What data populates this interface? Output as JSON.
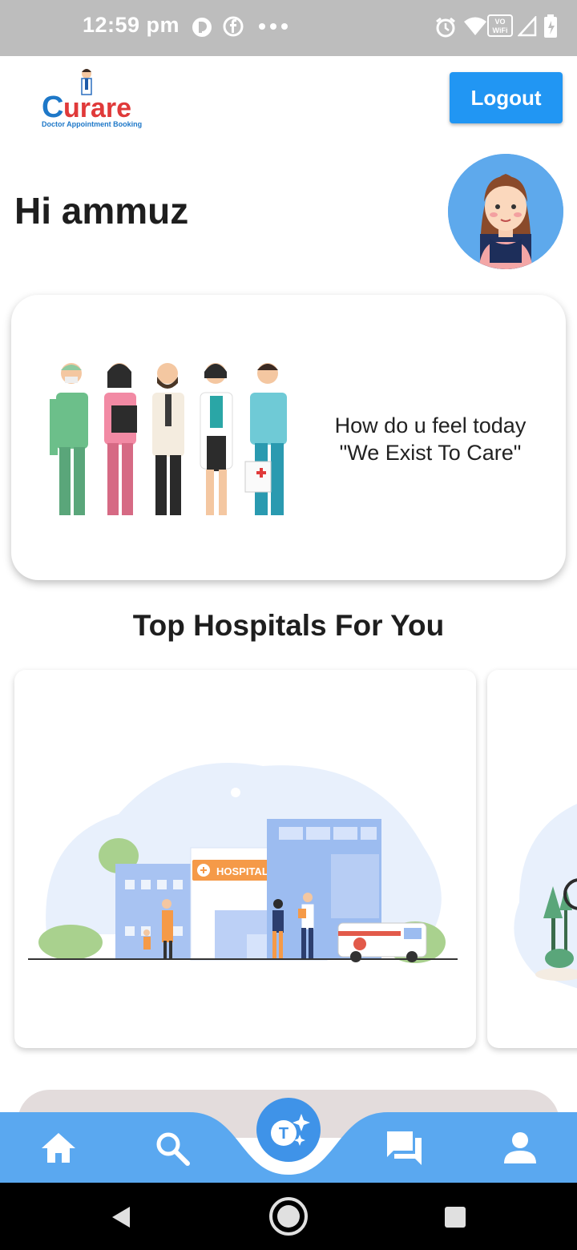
{
  "status_bar": {
    "time": "12:59 pm",
    "icons": [
      "notification-icon",
      "facebook-icon",
      "more-dots-icon",
      "alarm-icon",
      "wifi-icon",
      "vowifi-icon",
      "signal-icon",
      "battery-icon"
    ],
    "vowifi_label": "VO WiFi"
  },
  "app": {
    "logo_text": "Curare",
    "logo_subtitle": "Doctor Appointment Booking",
    "logout_label": "Logout"
  },
  "greeting": "Hi ammuz",
  "welcome_card": {
    "line1": "How do u feel today",
    "line2": "\"We Exist To Care\""
  },
  "section_title": "Top Hospitals For You",
  "hospital_card": {
    "sign_label": "HOSPITAL"
  },
  "bottom_nav": {
    "items": [
      "home-icon",
      "search-icon",
      "assistant-icon",
      "chat-icon",
      "profile-icon"
    ]
  },
  "colors": {
    "primary": "#2196f3",
    "nav": "#5aa8f0",
    "statusbar": "#bdbdbd"
  }
}
